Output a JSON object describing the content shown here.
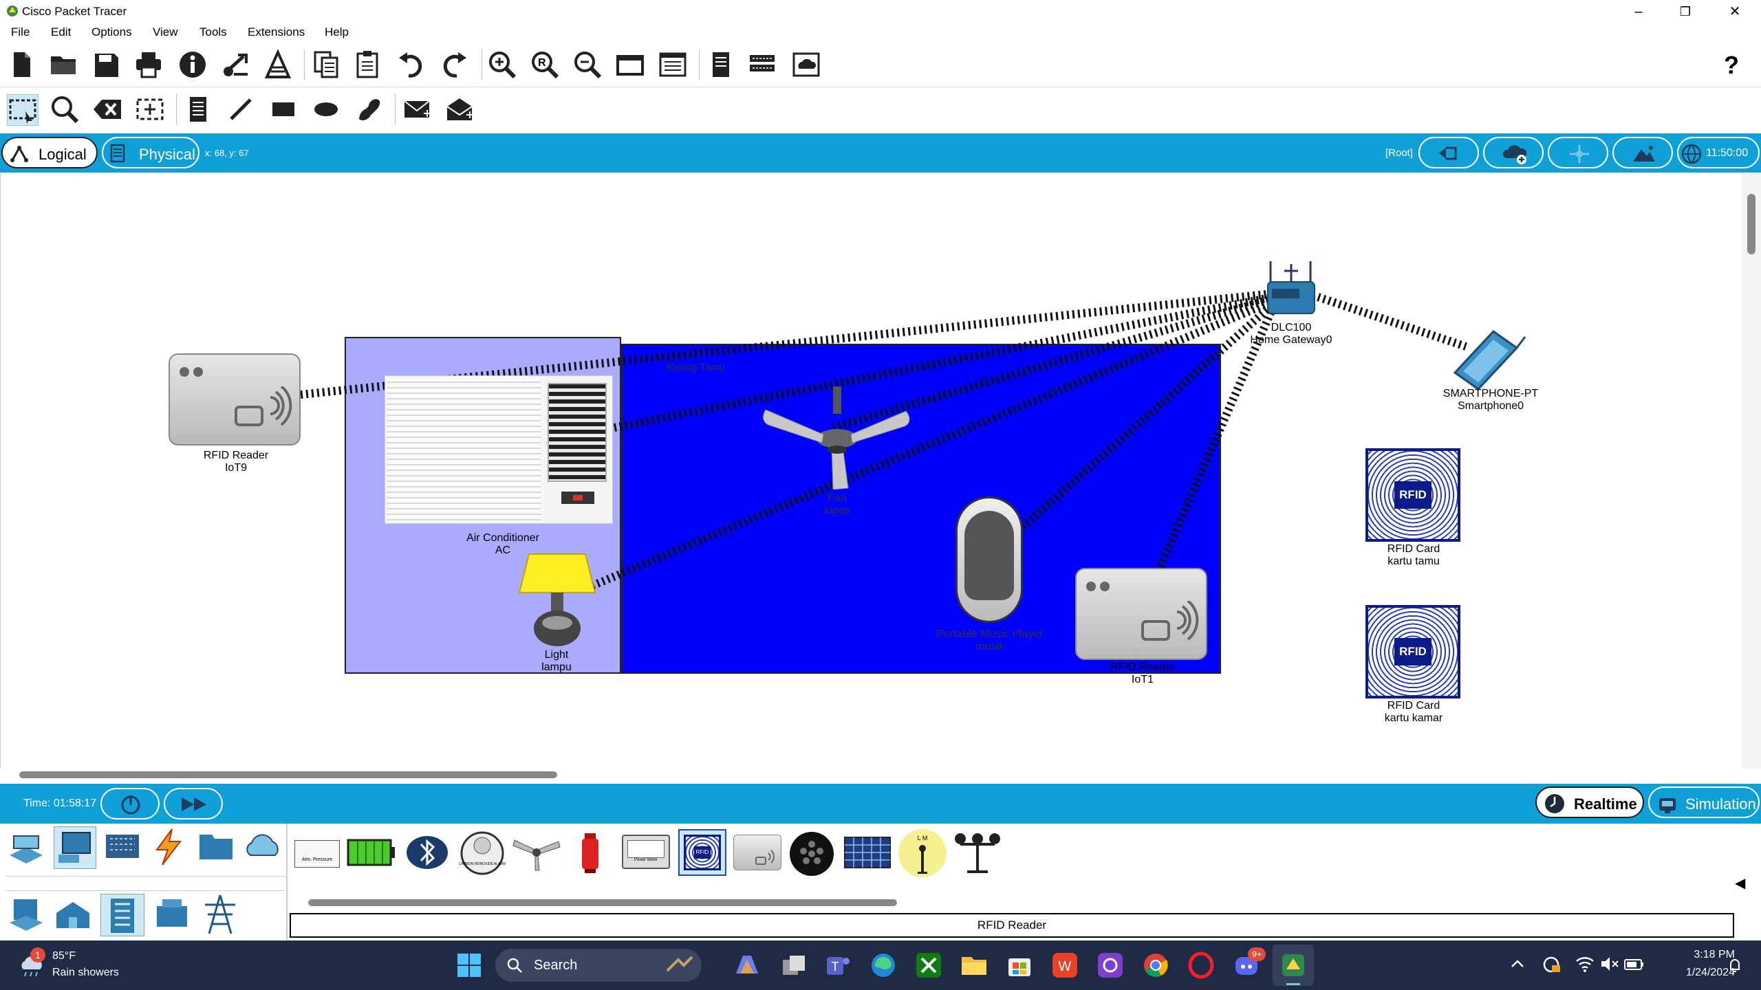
{
  "window": {
    "title": "Cisco Packet Tracer",
    "minimize": "–",
    "maximize": "❐",
    "close": "✕"
  },
  "menu": [
    "File",
    "Edit",
    "Options",
    "View",
    "Tools",
    "Extensions",
    "Help"
  ],
  "toolbar_icons": [
    "new-icon",
    "open-icon",
    "save-icon",
    "print-icon",
    "info-icon",
    "activity-wizard-icon",
    "custom-device-icon",
    "copy-icon",
    "paste-icon",
    "undo-icon",
    "redo-icon",
    "zoom-in-icon",
    "zoom-reset-icon",
    "zoom-out-icon",
    "drawing-palette-icon",
    "custom-devices-dialog-icon",
    "notes-icon",
    "device-list-icon",
    "cloud-viewer-icon"
  ],
  "help_glyph": "?",
  "toolbar2_icons": [
    "select-icon",
    "inspect-icon",
    "delete-icon",
    "resize-icon",
    "note-icon",
    "line-icon",
    "rectangle-icon",
    "ellipse-icon",
    "freeform-icon",
    "simple-pdu-icon",
    "complex-pdu-icon"
  ],
  "viewbar": {
    "logical_label": "Logical",
    "physical_label": "Physical",
    "coords": "x: 68, y: 67",
    "root_label": "[Root]",
    "clock": "11:50:00"
  },
  "workspace": {
    "room1_label": "",
    "room2_label": "Ruang Tamu",
    "devices": [
      {
        "name": "rfid-reader-iot9",
        "line1": "RFID Reader",
        "line2": "IoT9"
      },
      {
        "name": "air-conditioner",
        "line1": "Air Conditioner",
        "line2": "AC"
      },
      {
        "name": "light",
        "line1": "Light",
        "line2": "lampu"
      },
      {
        "name": "fan",
        "line1": "Fan",
        "line2": "kipas"
      },
      {
        "name": "music-player",
        "line1": "Portable Music Player",
        "line2": "musik"
      },
      {
        "name": "rfid-reader-iot1",
        "line1": "RFID Reader",
        "line2": "IoT1"
      },
      {
        "name": "home-gateway",
        "line1": "DLC100",
        "line2": "Home Gateway0"
      },
      {
        "name": "smartphone",
        "line1": "SMARTPHONE-PT",
        "line2": "Smartphone0"
      },
      {
        "name": "rfid-card-tamu",
        "line1": "RFID Card",
        "line2": "kartu tamu"
      },
      {
        "name": "rfid-card-kamar",
        "line1": "RFID Card",
        "line2": "kartu kamar"
      }
    ],
    "rfid_badge": "RFID"
  },
  "bottombar": {
    "time": "Time: 01:58:17",
    "realtime": "Realtime",
    "simulation": "Simulation"
  },
  "palette": {
    "status": "RFID Reader",
    "small_labels": [
      "Atm. Pressure",
      "CARBON MONOXIDE ALARM",
      "Power Meter",
      "RFID",
      "L M"
    ]
  },
  "taskbar": {
    "weather_temp": "85°F",
    "weather_desc": "Rain showers",
    "weather_badge": "1",
    "search_placeholder": "Search",
    "time": "3:18 PM",
    "date": "1/24/2024",
    "discord_badge": "9+"
  },
  "colors": {
    "accent": "#10a0d8",
    "room1": "#aaaaff",
    "room2": "#0000ff",
    "taskbar": "#1f2a44"
  }
}
